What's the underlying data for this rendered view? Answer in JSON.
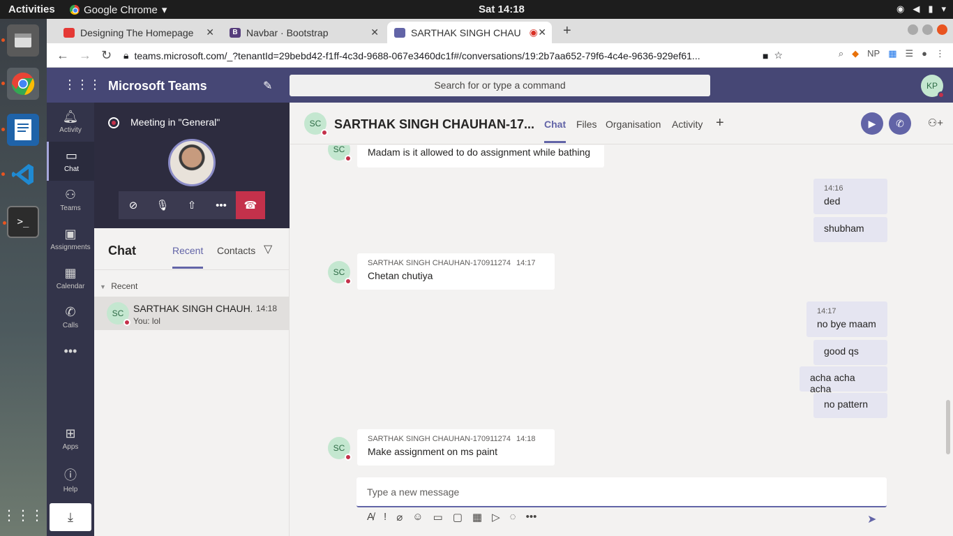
{
  "os": {
    "activities": "Activities",
    "app_name": "Google Chrome",
    "clock": "Sat 14:18"
  },
  "browser": {
    "tabs": [
      {
        "label": "Designing The Homepage",
        "icon_color": "#e53935"
      },
      {
        "label": "Navbar · Bootstrap",
        "icon_color": "#563d7c"
      },
      {
        "label": "SARTHAK SINGH CHAU",
        "icon_color": "#6264a7"
      }
    ],
    "url": "teams.microsoft.com/_?tenantId=29bebd42-f1ff-4c3d-9688-067e3460dc1f#/conversations/19:2b7aa652-79f6-4c4e-9636-929ef61..."
  },
  "teams": {
    "app_title": "Microsoft Teams",
    "search_placeholder": "Search for or type a command",
    "user_initials": "KP",
    "brand_color": "#464775",
    "accent_color": "#6264a7",
    "rail": [
      {
        "label": "Activity",
        "icon": "bell-icon"
      },
      {
        "label": "Chat",
        "icon": "chat-icon"
      },
      {
        "label": "Teams",
        "icon": "teams-icon"
      },
      {
        "label": "Assignments",
        "icon": "briefcase-icon"
      },
      {
        "label": "Calendar",
        "icon": "calendar-icon"
      },
      {
        "label": "Calls",
        "icon": "phone-icon"
      },
      {
        "label": "Apps",
        "icon": "apps-icon"
      },
      {
        "label": "Help",
        "icon": "help-icon"
      }
    ],
    "meeting": {
      "title": "Meeting in \"General\""
    },
    "chat_list": {
      "title": "Chat",
      "tab_recent": "Recent",
      "tab_contacts": "Contacts",
      "section_label": "Recent",
      "items": [
        {
          "initials": "SC",
          "name": "SARTHAK SINGH CHAUH...",
          "time": "14:18",
          "preview": "You: lol"
        }
      ]
    },
    "conversation": {
      "initials": "SC",
      "name": "SARTHAK SINGH CHAUHAN-17...",
      "tabs": [
        "Chat",
        "Files",
        "Organisation",
        "Activity"
      ],
      "messages": [
        {
          "from": "them",
          "sender": "",
          "time": "",
          "text": "Madam is it allowed to do assignment while bathing"
        },
        {
          "from": "me",
          "time": "14:16",
          "text": "ded"
        },
        {
          "from": "me",
          "time": "",
          "text": "shubham"
        },
        {
          "from": "them",
          "sender": "SARTHAK SINGH CHAUHAN-170911274",
          "time": "14:17",
          "text": "Chetan chutiya"
        },
        {
          "from": "me",
          "time": "14:17",
          "text": "no bye maam"
        },
        {
          "from": "me",
          "time": "",
          "text": "good qs"
        },
        {
          "from": "me",
          "time": "",
          "text": "acha acha acha"
        },
        {
          "from": "me",
          "time": "",
          "text": "no pattern"
        },
        {
          "from": "them",
          "sender": "SARTHAK SINGH CHAUHAN-170911274",
          "time": "14:18",
          "text": "Make assignment on ms paint"
        }
      ],
      "composer_placeholder": "Type a new message"
    }
  }
}
